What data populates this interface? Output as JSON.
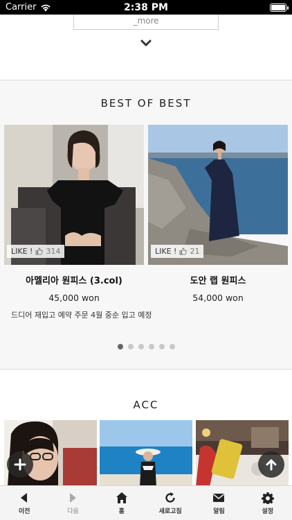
{
  "status": {
    "carrier": "Carrier",
    "time": "2:38 PM"
  },
  "more_label": "_more",
  "best": {
    "title": "BEST OF BEST",
    "products": [
      {
        "name": "아멜리아 원피스 (3.col)",
        "price": "45,000 won",
        "like_label": "LIKE !",
        "like_count": "314",
        "desc": "드디어 재입고 예약 주문 4월 중순 입고 예정"
      },
      {
        "name": "도안 랩 원피스",
        "price": "54,000 won",
        "like_label": "LIKE !",
        "like_count": "21",
        "desc": ""
      }
    ],
    "dots_count": 6,
    "active_dot": 0
  },
  "acc": {
    "title": "ACC"
  },
  "toolbar": {
    "back": "이전",
    "forward": "다음",
    "home": "홈",
    "refresh": "새로고침",
    "notice": "알림",
    "settings": "설정"
  },
  "colors": {
    "status_bg": "#000000",
    "section_bg": "#f7f7f7",
    "toolbar_bg": "#f4f4f4"
  }
}
